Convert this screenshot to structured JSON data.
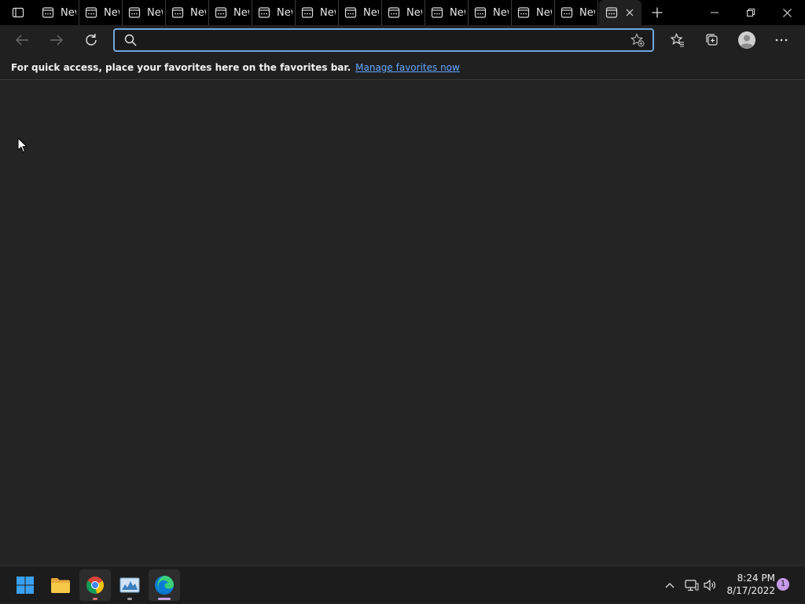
{
  "tabs": {
    "tab_label": "New Tab",
    "count_inactive": 13
  },
  "address": {
    "value": "",
    "placeholder": ""
  },
  "favbar": {
    "text": "For quick access, place your favorites here on the favorites bar.",
    "link": "Manage favorites now"
  },
  "taskbar": {
    "time": "8:24 PM",
    "date": "8/17/2022",
    "notifications": "1"
  },
  "colors": {
    "accent": "#6fa8dc",
    "link": "#63a8ff",
    "notification": "#c89ae8"
  }
}
